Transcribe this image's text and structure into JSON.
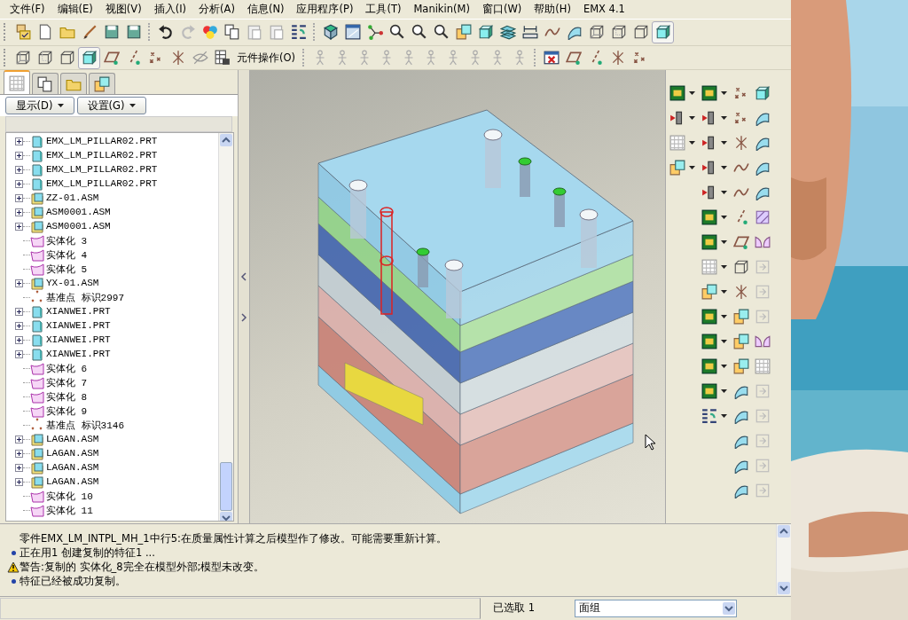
{
  "menu_bar": [
    {
      "label": "文件(F)"
    },
    {
      "label": "编辑(E)"
    },
    {
      "label": "视图(V)"
    },
    {
      "label": "插入(I)"
    },
    {
      "label": "分析(A)"
    },
    {
      "label": "信息(N)"
    },
    {
      "label": "应用程序(P)"
    },
    {
      "label": "工具(T)"
    },
    {
      "label": "Manikin(M)"
    },
    {
      "label": "窗口(W)"
    },
    {
      "label": "帮助(H)"
    },
    {
      "label": "EMX 4.1"
    }
  ],
  "top_toolbar": {
    "display_modes": [
      {
        "selected": false
      },
      {
        "selected": false
      },
      {
        "selected": false
      },
      {
        "selected": true
      }
    ]
  },
  "feature_toolbar": {
    "display_modes": [
      {
        "selected": false
      },
      {
        "selected": false
      },
      {
        "selected": false
      },
      {
        "selected": true
      }
    ],
    "button_label": "元件操作(O)"
  },
  "model_tree": {
    "tabs": [
      {
        "selected": true
      },
      {
        "selected": false
      },
      {
        "selected": false
      },
      {
        "selected": false
      }
    ],
    "buttons": [
      {
        "label": "显示(D)"
      },
      {
        "label": "设置(G)"
      }
    ],
    "items": [
      {
        "label": "EMX_LM_PILLAR02.PRT",
        "kind": "part",
        "expanded": false
      },
      {
        "label": "EMX_LM_PILLAR02.PRT",
        "kind": "part",
        "expanded": false
      },
      {
        "label": "EMX_LM_PILLAR02.PRT",
        "kind": "part",
        "expanded": false
      },
      {
        "label": "EMX_LM_PILLAR02.PRT",
        "kind": "part",
        "expanded": false
      },
      {
        "label": "ZZ-01.ASM",
        "kind": "assembly",
        "expanded": false
      },
      {
        "label": "ASM0001.ASM",
        "kind": "assembly",
        "expanded": false
      },
      {
        "label": "ASM0001.ASM",
        "kind": "assembly",
        "expanded": false
      },
      {
        "label": "实体化 3",
        "kind": "feature"
      },
      {
        "label": "实体化 4",
        "kind": "feature"
      },
      {
        "label": "实体化 5",
        "kind": "feature"
      },
      {
        "label": "YX-01.ASM",
        "kind": "assembly",
        "expanded": false
      },
      {
        "label": "基准点 标识2997",
        "kind": "datum"
      },
      {
        "label": "XIANWEI.PRT",
        "kind": "part",
        "expanded": false
      },
      {
        "label": "XIANWEI.PRT",
        "kind": "part",
        "expanded": false
      },
      {
        "label": "XIANWEI.PRT",
        "kind": "part",
        "expanded": false
      },
      {
        "label": "XIANWEI.PRT",
        "kind": "part",
        "expanded": false
      },
      {
        "label": "实体化 6",
        "kind": "feature"
      },
      {
        "label": "实体化 7",
        "kind": "feature"
      },
      {
        "label": "实体化 8",
        "kind": "feature"
      },
      {
        "label": "实体化 9",
        "kind": "feature"
      },
      {
        "label": "基准点 标识3146",
        "kind": "datum"
      },
      {
        "label": "LAGAN.ASM",
        "kind": "assembly",
        "expanded": false
      },
      {
        "label": "LAGAN.ASM",
        "kind": "assembly",
        "expanded": false
      },
      {
        "label": "LAGAN.ASM",
        "kind": "assembly",
        "expanded": false
      },
      {
        "label": "LAGAN.ASM",
        "kind": "assembly",
        "expanded": false
      },
      {
        "label": "实体化 10",
        "kind": "feature"
      },
      {
        "label": "实体化 11",
        "kind": "feature"
      }
    ]
  },
  "messages": [
    {
      "kind": "plain",
      "text": "零件EMX_LM_INTPL_MH_1中行5:在质量属性计算之后模型作了修改。可能需要重新计算。"
    },
    {
      "kind": "info",
      "text": "正在用1 创建复制的特征1 ..."
    },
    {
      "kind": "warning",
      "text": "警告:复制的 实体化_8完全在模型外部;模型未改变。"
    },
    {
      "kind": "info",
      "text": "特征已经被成功复制。"
    }
  ],
  "status_bar": {
    "selection": "已选取 1",
    "filter": "面组"
  }
}
